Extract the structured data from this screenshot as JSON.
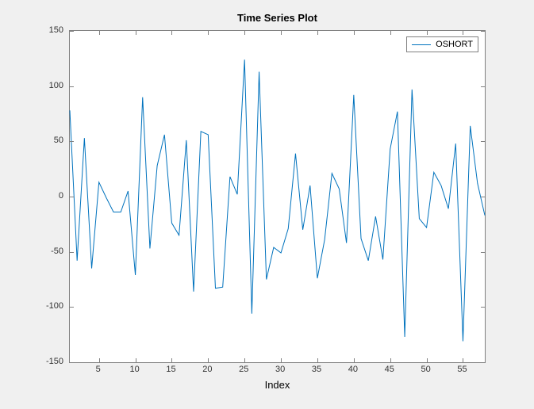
{
  "chart_data": {
    "type": "line",
    "title": "Time Series Plot",
    "xlabel": "Index",
    "ylabel": "",
    "xlim": [
      1,
      58
    ],
    "ylim": [
      -150,
      150
    ],
    "xticks": [
      5,
      10,
      15,
      20,
      25,
      30,
      35,
      40,
      45,
      50,
      55
    ],
    "yticks": [
      -150,
      -100,
      -50,
      0,
      50,
      100,
      150
    ],
    "series": [
      {
        "name": "OSHORT",
        "color": "#0072bd",
        "values": [
          78,
          -58,
          53,
          -65,
          13,
          -1,
          -14,
          -14,
          5,
          -71,
          90,
          -47,
          28,
          56,
          -24,
          -35,
          51,
          -86,
          59,
          56,
          -83,
          -82,
          18,
          2,
          124,
          -106,
          113,
          -75,
          -46,
          -51,
          -29,
          39,
          -30,
          10,
          -74,
          -39,
          21,
          7,
          -42,
          92,
          -38,
          -58,
          -18,
          -57,
          43,
          77,
          -127,
          97,
          -20,
          -28,
          22,
          10,
          -11,
          48,
          -131,
          64,
          12,
          -17
        ]
      }
    ],
    "legend": {
      "entries": [
        "OSHORT"
      ],
      "position": "northeast"
    }
  }
}
